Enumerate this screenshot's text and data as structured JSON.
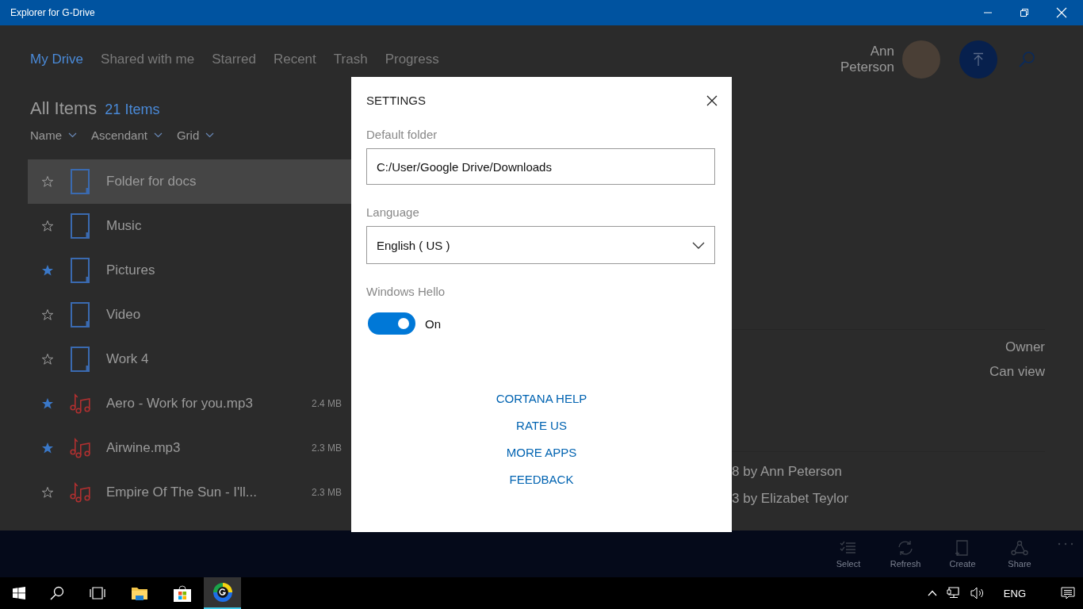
{
  "window": {
    "title": "Explorer for G-Drive"
  },
  "nav": {
    "tabs": [
      {
        "label": "My Drive",
        "selected": true
      },
      {
        "label": "Shared with me",
        "selected": false
      },
      {
        "label": "Starred",
        "selected": false
      },
      {
        "label": "Recent",
        "selected": false
      },
      {
        "label": "Trash",
        "selected": false
      },
      {
        "label": "Progress",
        "selected": false
      }
    ]
  },
  "user": {
    "name": "Ann Peterson"
  },
  "list": {
    "title": "All Items",
    "count": "21 Items",
    "sorts": [
      "Name",
      "Ascendant",
      "Grid"
    ],
    "items": [
      {
        "name": "Folder for docs",
        "kind": "folder",
        "starred": false,
        "selected": true
      },
      {
        "name": "Music",
        "kind": "folder",
        "starred": false,
        "selected": false
      },
      {
        "name": "Pictures",
        "kind": "folder",
        "starred": true,
        "selected": false
      },
      {
        "name": "Video",
        "kind": "folder",
        "starred": false,
        "selected": false
      },
      {
        "name": "Work 4",
        "kind": "folder",
        "starred": false,
        "selected": false
      },
      {
        "name": "Aero - Work  for you.mp3",
        "kind": "audio",
        "starred": true,
        "selected": false,
        "size": "2.4 MB"
      },
      {
        "name": "Airwine.mp3",
        "kind": "audio",
        "starred": true,
        "selected": false,
        "size": "2.3 MB"
      },
      {
        "name": "Empire Of The Sun - I'll...",
        "kind": "audio",
        "starred": false,
        "selected": false,
        "size": "2.3 MB"
      }
    ]
  },
  "details": {
    "roles": [
      "Owner",
      "Can view"
    ],
    "history": [
      "8 by Ann Peterson",
      "3 by Elizabet Teylor"
    ]
  },
  "command_bar": [
    {
      "label": "Select",
      "kind": "select"
    },
    {
      "label": "Refresh",
      "kind": "refresh"
    },
    {
      "label": "Create",
      "kind": "create"
    },
    {
      "label": "Share",
      "kind": "share"
    }
  ],
  "dialog": {
    "title": "SETTINGS",
    "default_folder": {
      "label": "Default folder",
      "value": "C:/User/Google Drive/Downloads"
    },
    "language": {
      "label": "Language",
      "value": "English ( US )"
    },
    "windows_hello": {
      "label": "Windows Hello",
      "on": true,
      "state_label": "On"
    },
    "links": [
      "CORTANA HELP",
      "RATE US",
      "MORE APPS",
      "FEEDBACK"
    ]
  },
  "taskbar": {
    "language": "ENG"
  }
}
